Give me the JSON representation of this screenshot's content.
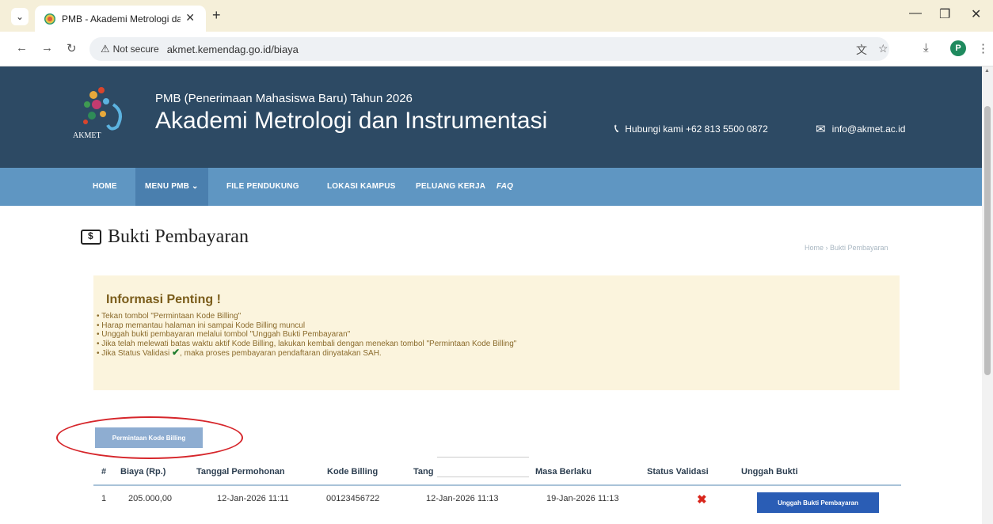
{
  "browser": {
    "tab_title": "PMB - Akademi Metrologi dan",
    "tab_close": "✕",
    "new_tab": "+",
    "not_secure": "Not secure",
    "url": "akmet.kemendag.go.id/biaya",
    "profile_initial": "P",
    "window_controls": {
      "minimize": "—",
      "restore": "❐",
      "close": "✕"
    }
  },
  "header": {
    "logo_text": "AKMET",
    "subtitle": "PMB (Penerimaan Mahasiswa Baru) Tahun 2026",
    "title": "Akademi Metrologi dan Instrumentasi",
    "phone": "Hubungi kami +62 813 5500 0872",
    "email": "info@akmet.ac.id"
  },
  "nav": {
    "home": "HOME",
    "menu_pmb": "MENU PMB ⌄",
    "file_pendukung": "FILE PENDUKUNG",
    "lokasi_kampus": "LOKASI KAMPUS",
    "peluang_kerja": "PELUANG KERJA",
    "faq": "FAQ"
  },
  "page": {
    "title": "Bukti Pembayaran",
    "breadcrumb": "Home › Bukti Pembayaran"
  },
  "info": {
    "title": "Informasi Penting !",
    "items": [
      "Tekan tombol \"Permintaan Kode Billing\"",
      "Harap memantau halaman ini sampai Kode Billing muncul",
      "Unggah bukti pembayaran melalui tombol \"Unggah Bukti Pembayaran\"",
      "Jika telah melewati batas waktu aktif Kode Billing, lakukan kembali dengan menekan tombol \"Permintaan Kode Billing\""
    ],
    "last_item_before": "Jika Status Validasi",
    "last_item_after": ", maka proses pembayaran pendaftaran dinyatakan SAH."
  },
  "billing_button": "Permintaan Kode Billing",
  "table": {
    "headers": [
      "#",
      "Biaya (Rp.)",
      "Tanggal Permohonan",
      "Kode Billing",
      "Tang",
      "Masa Berlaku",
      "Status Validasi",
      "Unggah Bukti"
    ],
    "rows": [
      {
        "no": "1",
        "biaya": "205.000,00",
        "tanggal_permohonan": "12-Jan-2026 11:11",
        "kode_billing": "00123456722",
        "tanggal": "12-Jan-2026 11:13",
        "masa_berlaku": "19-Jan-2026 11:13",
        "status_validasi": "✖",
        "unggah_label": "Unggah Bukti Pembayaran"
      }
    ]
  },
  "colors": {
    "header_bg": "#2d4a64",
    "nav_bg": "#5f96c2",
    "info_bg": "#fbf4dd",
    "upload_button": "#2a5db5",
    "annotation": "#d6262b"
  }
}
